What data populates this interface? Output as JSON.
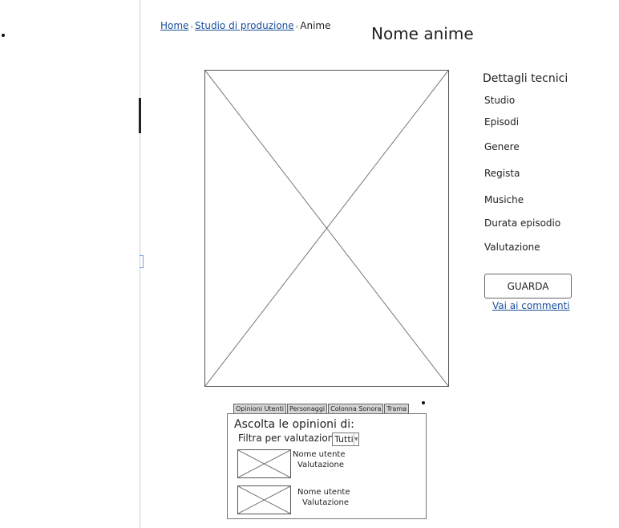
{
  "breadcrumb": {
    "home": "Home",
    "studio": "Studio di produzione",
    "current": "Anime",
    "separator": "›"
  },
  "page_title": "Nome anime",
  "details": {
    "heading": "Dettagli tecnici",
    "items": [
      "Studio",
      "Episodi",
      "Genere",
      "Regista",
      "Musiche",
      "Durata episodio",
      "Valutazione"
    ]
  },
  "actions": {
    "watch_label": "GUARDA",
    "comments_link": "Vai ai commenti"
  },
  "tabs": [
    "Opinioni Utenti",
    "Personaggi",
    "Colonna Sonora",
    "Trama"
  ],
  "opinions": {
    "heading": "Ascolta le opinioni di:",
    "filter_label": "Filtra per valutazione",
    "filter_value": "Tutti",
    "reviews": [
      {
        "user": "Nome utente",
        "rating": "Valutazione"
      },
      {
        "user": "Nome utente",
        "rating": "Valutazione"
      }
    ]
  },
  "icons": {
    "select_chevron": "chevron-down-icon"
  },
  "colors": {
    "link": "#1a4f9c",
    "tab_background": "#d4d4d4",
    "border": "#555555"
  }
}
